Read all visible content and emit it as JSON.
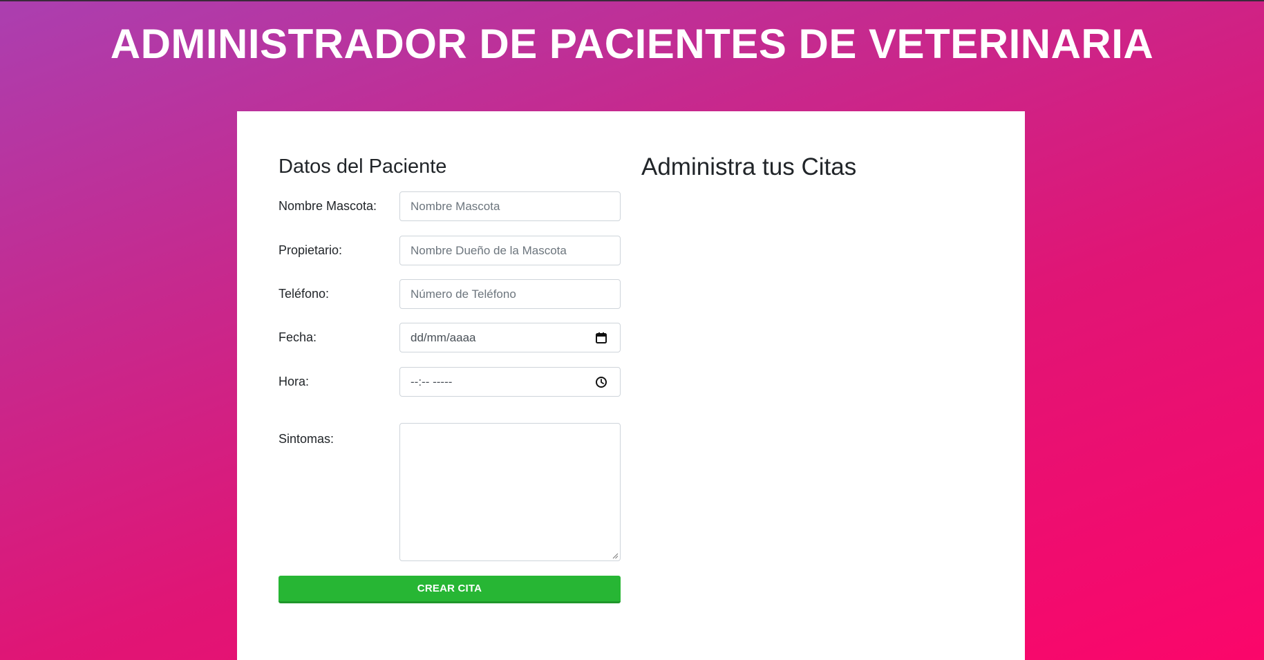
{
  "header": {
    "title": "ADMINISTRADOR DE PACIENTES DE VETERINARIA"
  },
  "form": {
    "title": "Datos del Paciente",
    "fields": {
      "mascota": {
        "label": "Nombre Mascota:",
        "placeholder": "Nombre Mascota"
      },
      "propietario": {
        "label": "Propietario:",
        "placeholder": "Nombre Dueño de la Mascota"
      },
      "telefono": {
        "label": "Teléfono:",
        "placeholder": "Número de Teléfono"
      },
      "fecha": {
        "label": "Fecha:",
        "value": "dd/mm/aaaa",
        "icon": "calendar-icon"
      },
      "hora": {
        "label": "Hora:",
        "value": "--:-- -----",
        "icon": "clock-icon"
      },
      "sintomas": {
        "label": "Sintomas:",
        "value": ""
      }
    },
    "submit_label": "CREAR CITA"
  },
  "citas": {
    "title": "Administra tus Citas"
  },
  "colors": {
    "gradient_start": "#ab3fb0",
    "gradient_end": "#fb066a",
    "button": "#27b634",
    "card": "#ffffff"
  }
}
